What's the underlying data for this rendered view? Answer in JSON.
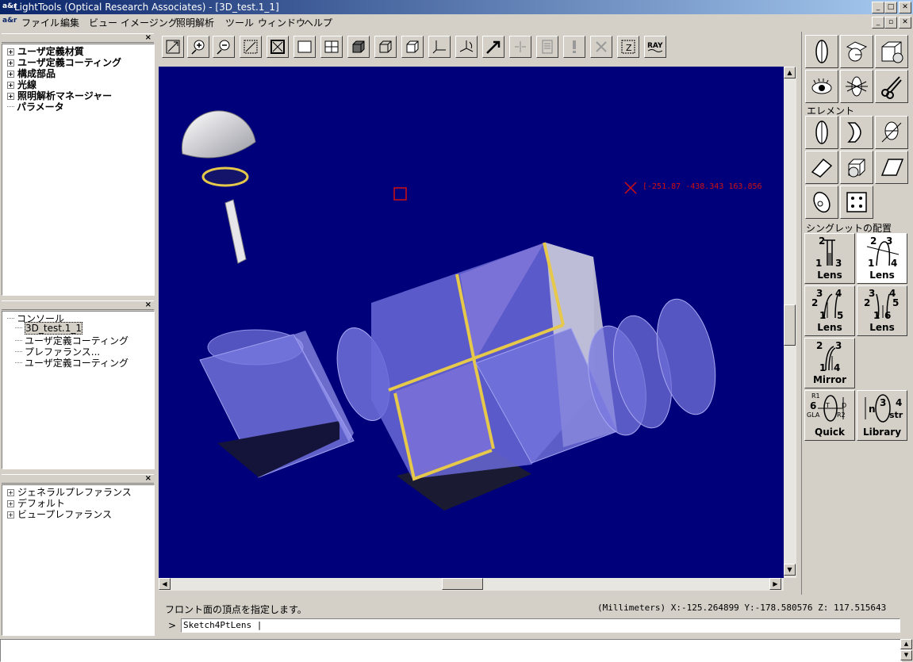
{
  "app": {
    "title": "LightTools (Optical Research Associates) - [3D_test.1_1]",
    "icon_text": "a&r"
  },
  "menu": [
    "ファイル",
    "編集",
    "ビュー",
    "イメージング",
    "照明解析",
    "ツール",
    "ウィンドウ",
    "ヘルプ"
  ],
  "tree_panel": {
    "items": [
      {
        "label": "ユーザ定義材質",
        "expandable": true
      },
      {
        "label": "ユーザ定義コーティング",
        "expandable": true
      },
      {
        "label": "構成部品",
        "expandable": true
      },
      {
        "label": "光線",
        "expandable": true
      },
      {
        "label": "照明解析マネージャー",
        "expandable": true
      },
      {
        "label": "パラメータ",
        "expandable": false
      }
    ]
  },
  "console_panel": {
    "items": [
      {
        "label": "コンソール",
        "indent": 0,
        "selected": false
      },
      {
        "label": "3D_test.1_1",
        "indent": 1,
        "selected": true
      },
      {
        "label": "ユーザ定義コーティング",
        "indent": 1,
        "selected": false
      },
      {
        "label": "プレファランス...",
        "indent": 1,
        "selected": false
      },
      {
        "label": "ユーザ定義コーティング",
        "indent": 1,
        "selected": false
      }
    ]
  },
  "prefs_panel": {
    "items": [
      {
        "label": "ジェネラルプレファランス"
      },
      {
        "label": "デフォルト"
      },
      {
        "label": "ビュープレファランス"
      }
    ]
  },
  "toolbar": {
    "icons": [
      "zoom-fit-icon",
      "zoom-in-icon",
      "zoom-out-icon",
      "zoom-window-icon",
      "zoom-extents-icon",
      "single-view-icon",
      "quad-view-icon",
      "shaded-cube-icon",
      "wire-cube-icon",
      "hidden-line-cube-icon",
      "axes-icon",
      "rotate-axes-icon",
      "arrow-pointer-icon",
      "mirror-disabled-icon",
      "document-disabled-icon",
      "alert-disabled-icon",
      "cross-disabled-icon",
      "zoom-z-icon",
      "ray-trace-icon"
    ],
    "ray_label": "RAY",
    "z_label": "Z"
  },
  "viewport": {
    "bg_color": "#00007b",
    "coord_readout": "[-251.87 -438.343 163.856"
  },
  "palette": {
    "element_label": "エレメント",
    "singlet_label": "シングレットの配置",
    "big_buttons": [
      {
        "label": "Lens"
      },
      {
        "label": "Lens"
      },
      {
        "label": "Lens"
      },
      {
        "label": "Lens"
      },
      {
        "label": "Mirror"
      },
      {
        "label": "Quick"
      },
      {
        "label": "Library"
      }
    ],
    "digits": {
      "n1": "1",
      "n2": "2",
      "n3": "3",
      "n4": "4",
      "n5": "5",
      "n6": "6",
      "r1": "R1",
      "r2": "R2",
      "t": "T",
      "d": "D",
      "gla": "GLA",
      "str": "str",
      "n": "n"
    }
  },
  "status": {
    "message": "フロント面の頂点を指定します。",
    "coords": "(Millimeters) X:-125.264899 Y:-178.580576 Z: 117.515643",
    "prompt": ">",
    "command": "Sketch4PtLens |"
  },
  "colors": {
    "titlebar_start": "#0a246a",
    "titlebar_end": "#a6caf0",
    "face": "#d4d0c8",
    "edge_yellow": "#e6c84a",
    "glass": "#8c8cf0",
    "marker_red": "#d01010"
  }
}
